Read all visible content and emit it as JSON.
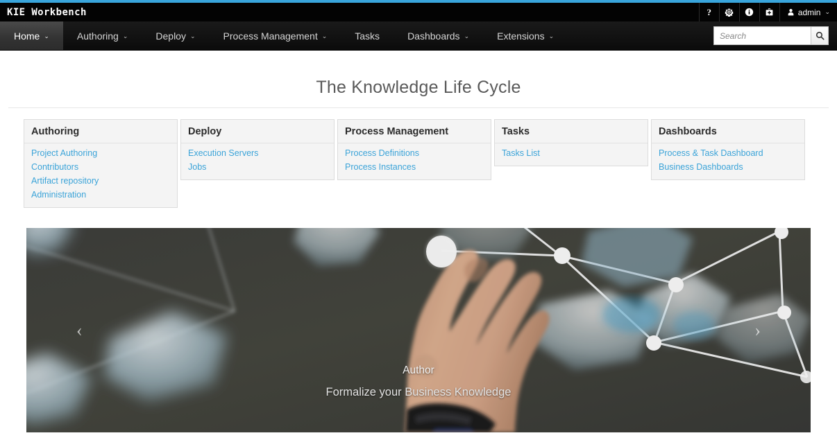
{
  "theme": {
    "accent": "#39a5dc",
    "link": "#3aa3d8",
    "masthead_bg": "#030303",
    "navbar_bg": "#131313",
    "card_bg": "#f4f4f4"
  },
  "masthead": {
    "brand": "KIE Workbench",
    "utility_icons": [
      {
        "name": "help-icon",
        "glyph": "?"
      },
      {
        "name": "gear-icon",
        "glyph": "gear"
      },
      {
        "name": "info-icon",
        "glyph": "info"
      },
      {
        "name": "briefcase-icon",
        "glyph": "briefcase"
      }
    ],
    "user": {
      "name": "admin",
      "caret": "⌄"
    }
  },
  "navbar": {
    "items": [
      {
        "label": "Home",
        "has_caret": true,
        "active": true
      },
      {
        "label": "Authoring",
        "has_caret": true,
        "active": false
      },
      {
        "label": "Deploy",
        "has_caret": true,
        "active": false
      },
      {
        "label": "Process Management",
        "has_caret": true,
        "active": false
      },
      {
        "label": "Tasks",
        "has_caret": false,
        "active": false
      },
      {
        "label": "Dashboards",
        "has_caret": true,
        "active": false
      },
      {
        "label": "Extensions",
        "has_caret": true,
        "active": false
      }
    ],
    "caret_glyph": "⌄",
    "search": {
      "placeholder": "Search",
      "value": ""
    }
  },
  "page": {
    "title": "The Knowledge Life Cycle"
  },
  "cards": [
    {
      "title": "Authoring",
      "links": [
        "Project Authoring",
        "Contributors",
        "Artifact repository",
        "Administration"
      ]
    },
    {
      "title": "Deploy",
      "links": [
        "Execution Servers",
        "Jobs"
      ]
    },
    {
      "title": "Process Management",
      "links": [
        "Process Definitions",
        "Process Instances"
      ]
    },
    {
      "title": "Tasks",
      "links": [
        "Tasks List"
      ]
    },
    {
      "title": "Dashboards",
      "links": [
        "Process & Task Dashboard",
        "Business Dashboards"
      ]
    }
  ],
  "carousel": {
    "prev_glyph": "‹",
    "next_glyph": "›",
    "slide": {
      "caption_title": "Author",
      "caption_subtitle": "Formalize your Business Knowledge",
      "image_alt": "Hand touching a network of glowing nodes and translucent crystals"
    }
  }
}
